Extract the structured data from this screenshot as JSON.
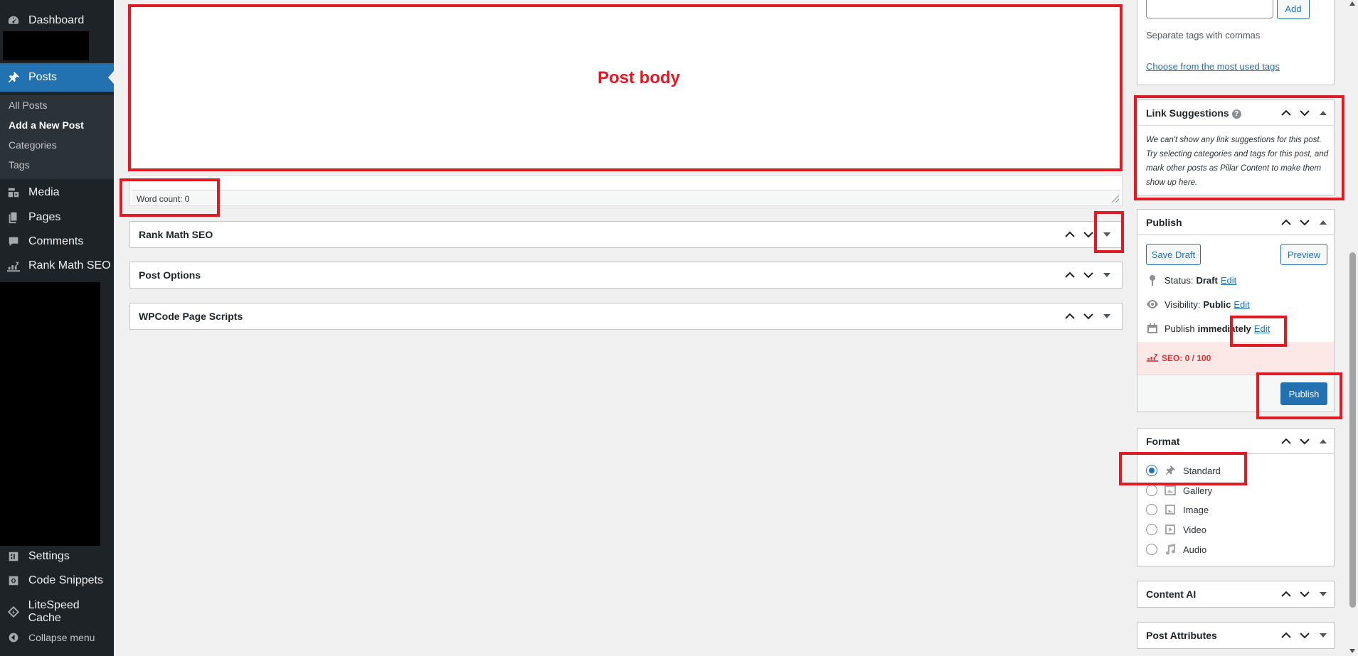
{
  "sidebar": {
    "dashboard": "Dashboard",
    "posts": "Posts",
    "submenu": [
      "All Posts",
      "Add a New Post",
      "Categories",
      "Tags"
    ],
    "media": "Media",
    "pages": "Pages",
    "comments": "Comments",
    "rank_math": "Rank Math SEO",
    "settings": "Settings",
    "code_snippets": "Code Snippets",
    "litespeed": "LiteSpeed Cache",
    "collapse": "Collapse menu"
  },
  "editor": {
    "post_body_label": "Post body",
    "word_count": "Word count: 0"
  },
  "metaboxes": {
    "rank_math": "Rank Math SEO",
    "post_options": "Post Options",
    "wpcode": "WPCode Page Scripts"
  },
  "tags_box": {
    "add_button": "Add",
    "hint": "Separate tags with commas",
    "choose_link": "Choose from the most used tags"
  },
  "link_suggestions": {
    "title": "Link Suggestions",
    "help": "?",
    "text": "We can't show any link suggestions for this post. Try selecting categories and tags for this post, and mark other posts as Pillar Content to make them show up here."
  },
  "publish": {
    "title": "Publish",
    "save_draft": "Save Draft",
    "preview": "Preview",
    "status_label": "Status:",
    "status_value": "Draft",
    "visibility_label": "Visibility:",
    "visibility_value": "Public",
    "publish_label": "Publish",
    "publish_value": "immediately",
    "edit": "Edit",
    "seo_score": "SEO: 0 / 100",
    "publish_button": "Publish"
  },
  "format": {
    "title": "Format",
    "options": [
      "Standard",
      "Gallery",
      "Image",
      "Video",
      "Audio"
    ],
    "selected": "Standard"
  },
  "content_ai": {
    "title": "Content AI"
  },
  "post_attributes": {
    "title": "Post Attributes"
  },
  "colors": {
    "sidebar_bg": "#1d2327",
    "active_blue": "#2271b1",
    "annotation_red": "#e01b24",
    "seo_bg": "#fde8e8"
  }
}
